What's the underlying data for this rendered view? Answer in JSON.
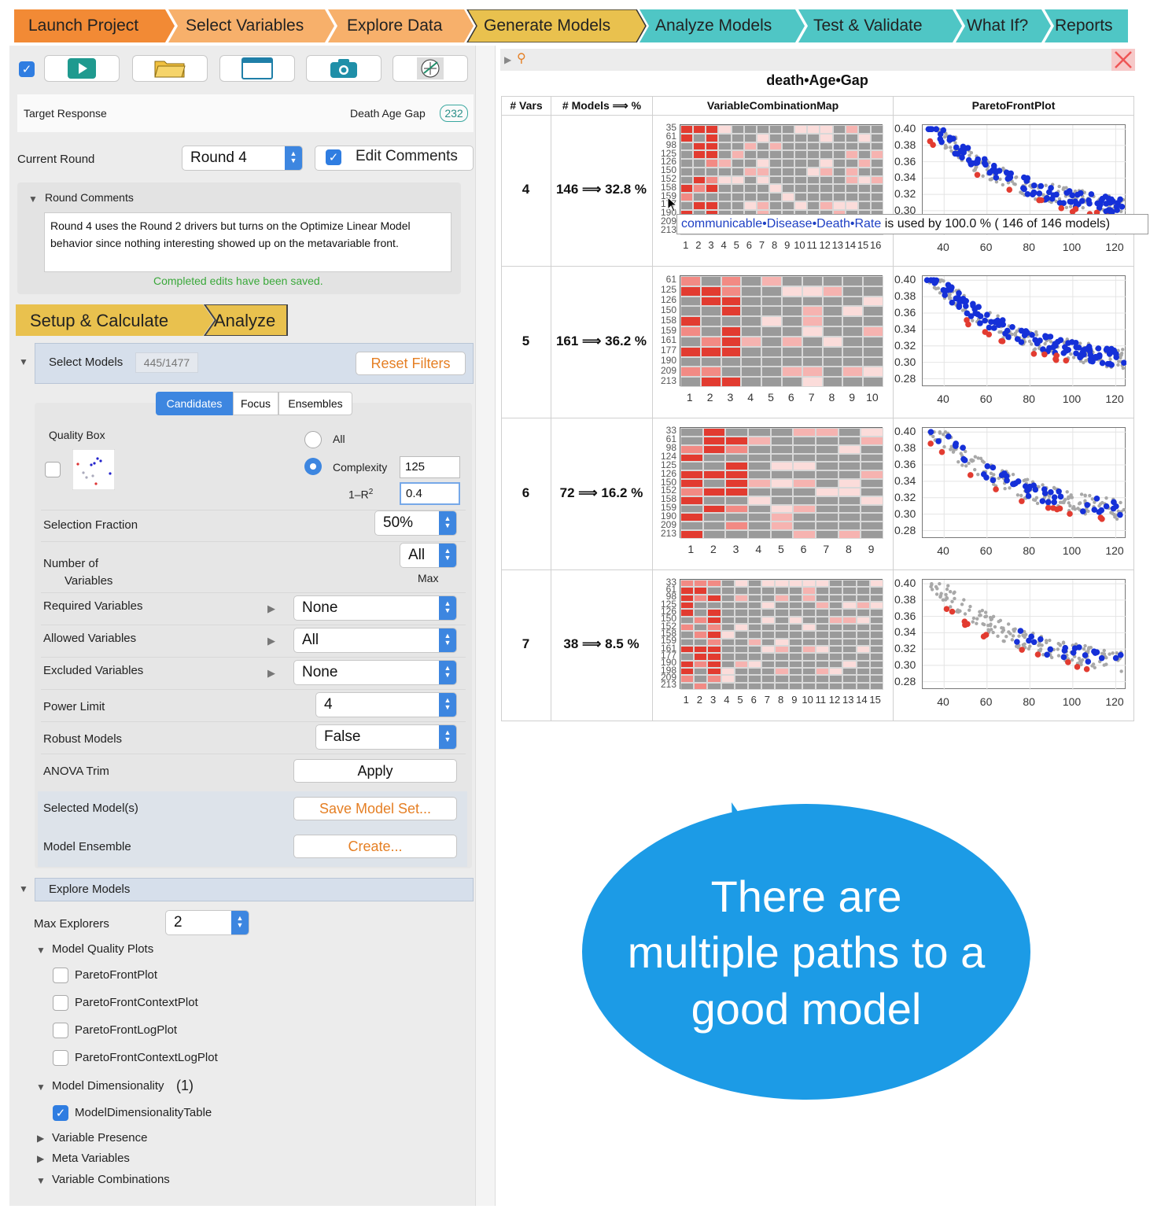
{
  "nav": [
    {
      "label": "Launch Project",
      "color": "#f28a35"
    },
    {
      "label": "Select Variables",
      "color": "#f7b06b"
    },
    {
      "label": "Explore Data",
      "color": "#f7b06b"
    },
    {
      "label": "Generate Models",
      "color": "#e9c14e"
    },
    {
      "label": "Analyze Models",
      "color": "#4fc6c5"
    },
    {
      "label": "Test & Validate",
      "color": "#4fc6c5"
    },
    {
      "label": "What If?",
      "color": "#4fc6c5"
    },
    {
      "label": "Reports",
      "color": "#4fc6c5"
    }
  ],
  "left": {
    "target_label": "Target Response",
    "target_value": "Death Age Gap",
    "target_count": "232",
    "round_label": "Current Round",
    "round_value": "Round 4",
    "edit_comments": "Edit Comments",
    "round_comments_label": "Round Comments",
    "comments_text": "Round 4 uses the Round 2 drivers but turns on the Optimize Linear Model behavior since nothing interesting showed up on the metavariable front.",
    "saved_msg": "Completed edits have been saved.",
    "setup_tab": "Setup & Calculate",
    "analyze_tab": "Analyze",
    "select_models": "Select Models",
    "select_count": "445/1477",
    "reset_filters": "Reset Filters",
    "subtabs": [
      "Candidates",
      "Focus",
      "Ensembles"
    ],
    "quality_box": "Quality Box",
    "opt_all": "All",
    "opt_complexity": "Complexity",
    "complexity_value": "125",
    "r2_label": "1–R",
    "r2_sup": "2",
    "r2_value": "0.4",
    "selection_fraction": "Selection Fraction",
    "selection_fraction_value": "50%",
    "num_vars_label_1": "Number of",
    "num_vars_label_2": "Variables",
    "num_vars_value": "All",
    "num_vars_max": "Max",
    "required_vars": "Required Variables",
    "required_value": "None",
    "allowed_vars": "Allowed Variables",
    "allowed_value": "All",
    "excluded_vars": "Excluded Variables",
    "excluded_value": "None",
    "power_limit": "Power Limit",
    "power_value": "4",
    "robust_models": "Robust Models",
    "robust_value": "False",
    "anova_trim": "ANOVA Trim",
    "apply": "Apply",
    "selected_models": "Selected Model(s)",
    "save_model_set": "Save Model Set...",
    "model_ensemble": "Model Ensemble",
    "create": "Create...",
    "explore_models": "Explore Models",
    "max_explorers": "Max Explorers",
    "max_explorers_value": "2",
    "model_quality_plots": "Model Quality Plots",
    "quality_plots": [
      "ParetoFrontPlot",
      "ParetoFrontContextPlot",
      "ParetoFrontLogPlot",
      "ParetoFrontContextLogPlot"
    ],
    "model_dimensionality": "Model Dimensionality",
    "model_dimensionality_count": "(1)",
    "dim_table": "ModelDimensionalityTable",
    "variable_presence": "Variable Presence",
    "meta_variables": "Meta Variables",
    "variable_combinations": "Variable Combinations"
  },
  "right": {
    "title": "death•Age•Gap",
    "headers": [
      "# Vars",
      "# Models ⟹ %",
      "VariableCombinationMap",
      "ParetoFrontPlot"
    ],
    "rows": [
      {
        "vars": "4",
        "models": "146 ⟹ 32.8 %",
        "ylabels": [
          "35",
          "61",
          "98",
          "125",
          "126",
          "150",
          "152",
          "158",
          "159",
          "177",
          "190",
          "209",
          "213"
        ],
        "xlabels": [
          "1",
          "2",
          "3",
          "4",
          "5",
          "6",
          "7",
          "8",
          "9",
          "10",
          "11",
          "12",
          "13",
          "14",
          "15",
          "16"
        ]
      },
      {
        "vars": "5",
        "models": "161 ⟹ 36.2 %",
        "ylabels": [
          "61",
          "125",
          "126",
          "150",
          "158",
          "159",
          "161",
          "177",
          "190",
          "209",
          "213"
        ],
        "xlabels": [
          "1",
          "2",
          "3",
          "4",
          "5",
          "6",
          "7",
          "8",
          "9",
          "10"
        ]
      },
      {
        "vars": "6",
        "models": "72 ⟹ 16.2 %",
        "ylabels": [
          "33",
          "61",
          "98",
          "124",
          "125",
          "126",
          "150",
          "152",
          "158",
          "159",
          "190",
          "209",
          "213"
        ],
        "xlabels": [
          "1",
          "2",
          "3",
          "4",
          "5",
          "6",
          "7",
          "8",
          "9"
        ]
      },
      {
        "vars": "7",
        "models": "38 ⟹ 8.5 %",
        "ylabels": [
          "33",
          "61",
          "98",
          "125",
          "126",
          "150",
          "152",
          "158",
          "159",
          "161",
          "177",
          "190",
          "198",
          "209",
          "213"
        ],
        "xlabels": [
          "1",
          "2",
          "3",
          "4",
          "5",
          "6",
          "7",
          "8",
          "9",
          "10",
          "11",
          "12",
          "13",
          "14",
          "15"
        ]
      }
    ],
    "pareto_yticks": [
      "0.40",
      "0.38",
      "0.36",
      "0.34",
      "0.32",
      "0.30",
      "0.28"
    ],
    "pareto_xticks": [
      "40",
      "60",
      "80",
      "100",
      "120"
    ],
    "tooltip_var": "communicable•Disease•Death•Rate",
    "tooltip_rest": "is used by 100.0 % ( 146 of 146 models)",
    "bubble_text": [
      "There are",
      "multiple paths to a",
      "good model"
    ]
  }
}
